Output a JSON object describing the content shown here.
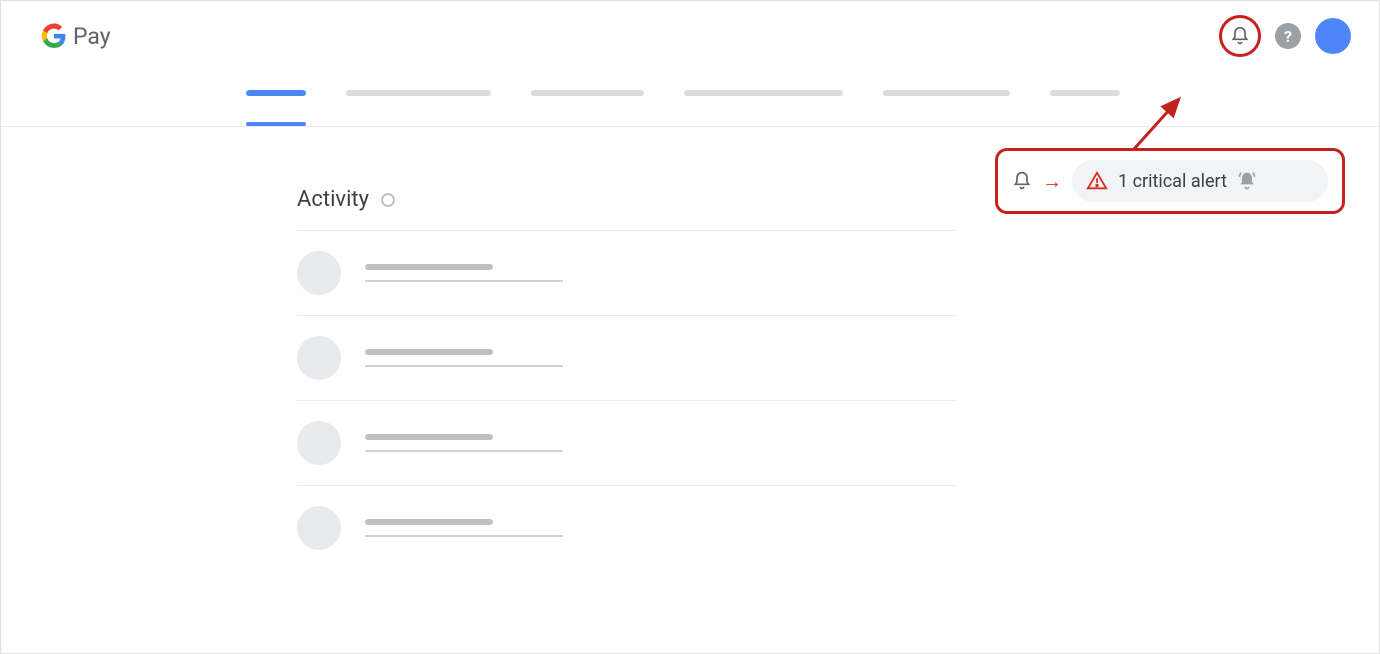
{
  "brand": {
    "name": "Pay"
  },
  "header": {
    "bell_label": "Notifications",
    "help_label": "Help",
    "avatar_label": "Account"
  },
  "content": {
    "section_title": "Activity"
  },
  "callout": {
    "alert_count": "1",
    "alert_text": "critical alert"
  }
}
